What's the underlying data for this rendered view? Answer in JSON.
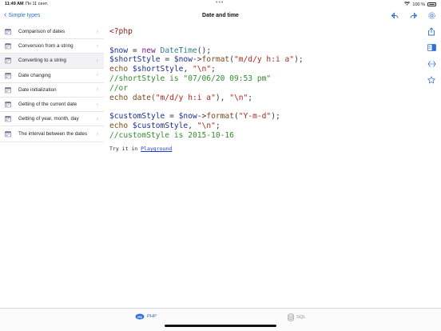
{
  "status": {
    "time": "11:49 AM",
    "date": "Пн 11 сент.",
    "battery": "100 %"
  },
  "nav": {
    "back_label": "Simple types",
    "title": "Date and time"
  },
  "sidebar": {
    "items": [
      {
        "label": "Comparison of dates"
      },
      {
        "label": "Conversion from a string"
      },
      {
        "label": "Converting to a string"
      },
      {
        "label": "Date changing"
      },
      {
        "label": "Date initialization"
      },
      {
        "label": "Getting of the current date"
      },
      {
        "label": "Getting of year, month, day"
      },
      {
        "label": "The interval between the dates"
      }
    ]
  },
  "code": {
    "l1": "<?php",
    "l2a": "$now",
    "l2b": " = ",
    "l2c": "new ",
    "l2d": "DateTime",
    "l2e": "();",
    "l3a": "$shortStyle",
    "l3b": " = ",
    "l3c": "$now",
    "l3d": "->",
    "l3e": "format",
    "l3f": "(",
    "l3g": "\"m/d/y h:i a\"",
    "l3h": ");",
    "l4a": "echo ",
    "l4b": "$shortStyle",
    "l4c": ", ",
    "l4d": "\"\\n\"",
    "l4e": ";",
    "l5": "//shortStyle is \"07/06/20 09:53 pm\"",
    "l6": "//or",
    "l7a": "echo date(",
    "l7b": "\"m/d/y h:i a\"",
    "l7c": "), ",
    "l7d": "\"\\n\"",
    "l7e": ";",
    "l8a": "$customStyle",
    "l8b": " = ",
    "l8c": "$now",
    "l8d": "->",
    "l8e": "format",
    "l8f": "(",
    "l8g": "\"Y-m-d\"",
    "l8h": ");",
    "l9a": "echo ",
    "l9b": "$customStyle",
    "l9c": ", ",
    "l9d": "\"\\n\"",
    "l9e": ";",
    "l10": "//customStyle is 2015-10-16"
  },
  "tryit": {
    "prefix": "Try it in ",
    "link": "Playground"
  },
  "tabs": {
    "php": "PHP",
    "sql": "SQL",
    "php_badge": "php"
  },
  "colors": {
    "accent": "#2f6fd6",
    "inactive": "#8e8e93"
  }
}
